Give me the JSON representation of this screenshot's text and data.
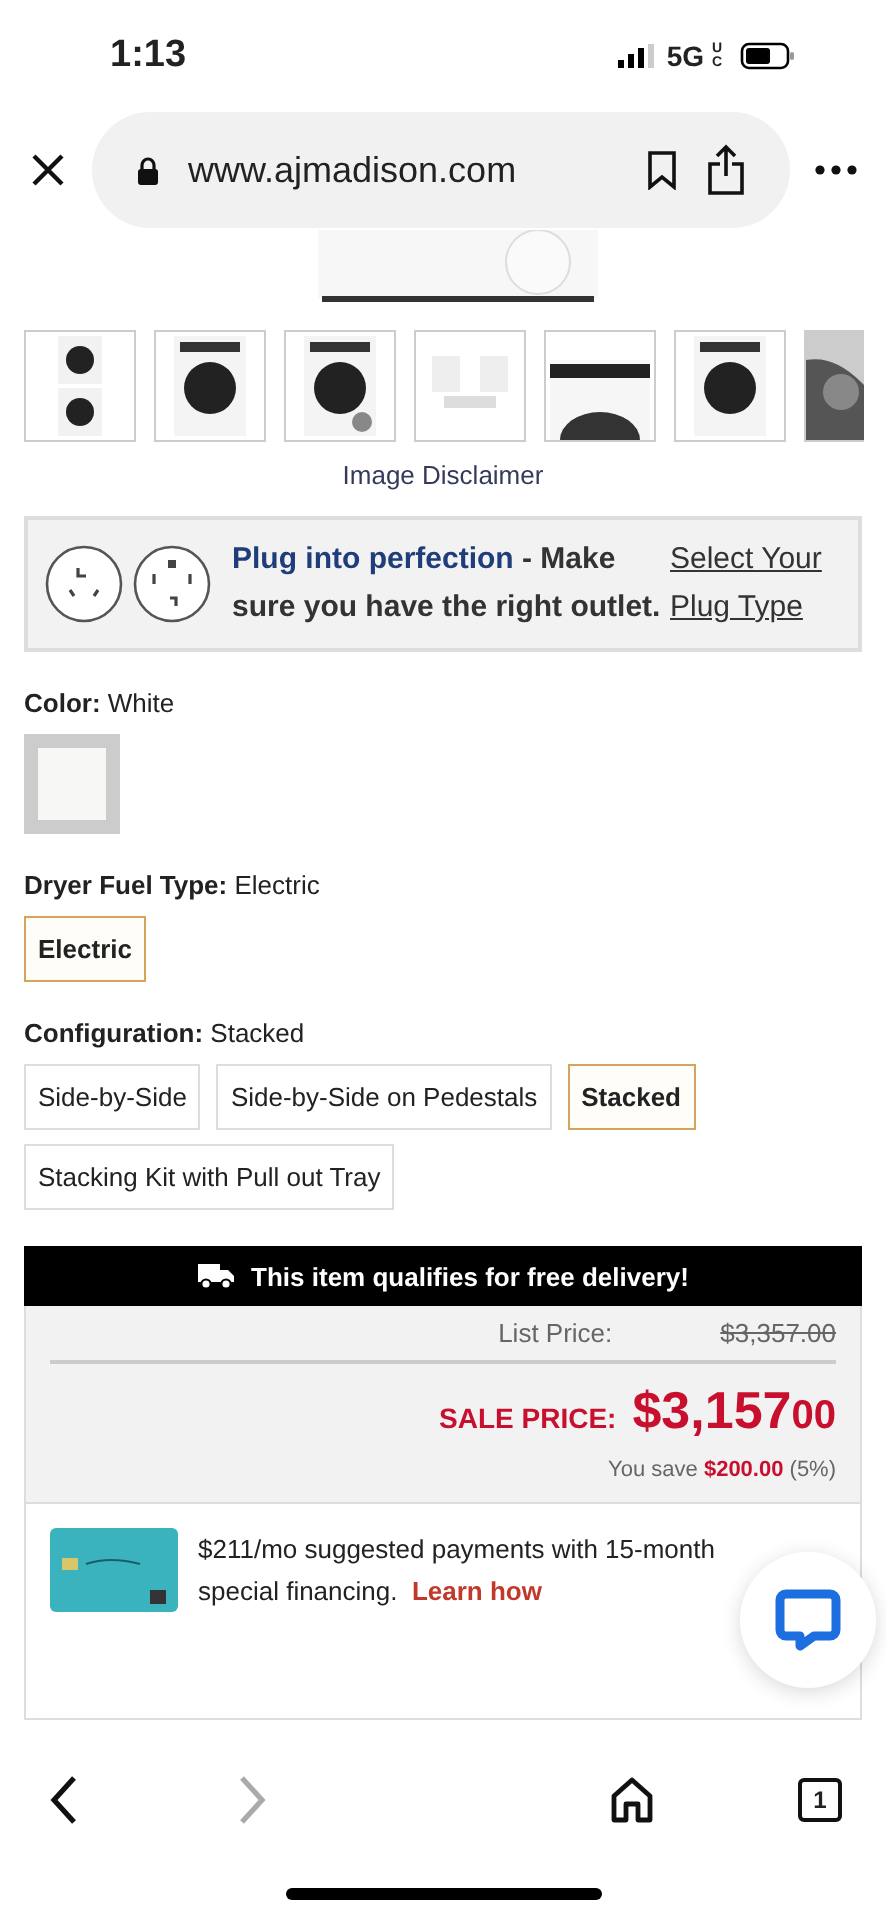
{
  "status_bar": {
    "time": "1:13",
    "network": "5G",
    "network_sub": "UC"
  },
  "browser": {
    "url": "www.ajmadison.com"
  },
  "gallery": {
    "disclaimer": "Image Disclaimer"
  },
  "plug_banner": {
    "text": "**Plug into perfection** - Make sure you have the right outlet.",
    "link": "Select Your Plug Type"
  },
  "options": [
    {
      "label": "Color:",
      "value": "White",
      "kind": "swatch"
    },
    {
      "label": "Dryer Fuel Type:",
      "value": "Electric",
      "kind": "buttons",
      "choices": [
        {
          "label": "Electric",
          "selected": true
        }
      ]
    },
    {
      "label": "Configuration:",
      "value": "Stacked",
      "kind": "buttons",
      "choices": [
        {
          "label": "Side-by-Side",
          "selected": false
        },
        {
          "label": "Side-by-Side on Pedestals",
          "selected": false
        },
        {
          "label": "Stacked",
          "selected": true
        },
        {
          "label": "Stacking Kit with Pull out Tray",
          "selected": false
        }
      ]
    }
  ],
  "delivery_banner": "This item qualifies for free delivery!",
  "pricing": {
    "list_label": "List Price:",
    "list_price": "$3,357.00",
    "sale_label": "SALE PRICE:",
    "sale_price": "$3,157",
    "sale_cents": "00",
    "savings": "You save **$200.00** (5%)"
  },
  "financing": {
    "text": "$211/mo suggested payments with 15-month special financing.",
    "link": "Learn how"
  },
  "toolbar": {
    "tab_count": "1"
  }
}
